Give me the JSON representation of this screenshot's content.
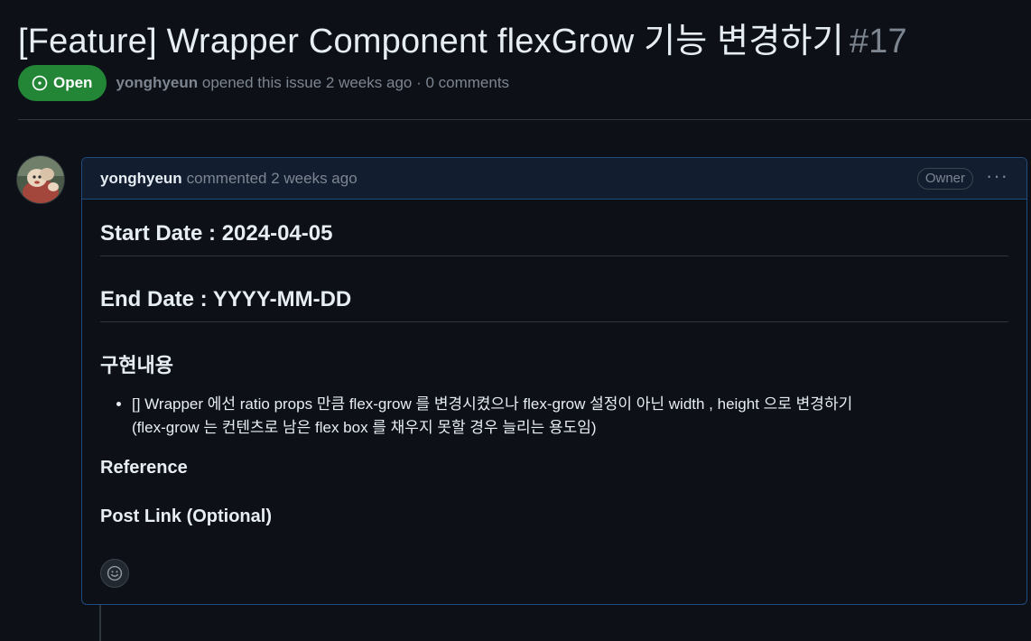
{
  "issue": {
    "title": "[Feature] Wrapper Component flexGrow 기능 변경하기",
    "number": "#17",
    "state": "Open",
    "author": "yonghyeun",
    "meta_text": "opened this issue 2 weeks ago · 0 comments"
  },
  "comment": {
    "author": "yonghyeun",
    "meta": "commented 2 weeks ago",
    "role_badge": "Owner",
    "menu_glyph": "···",
    "start_date": "Start Date : 2024-04-05",
    "end_date": "End Date : YYYY-MM-DD",
    "section_heading": "구현내용",
    "list_items": [
      {
        "line1": "[] Wrapper 에선 ratio props 만큼 flex-grow 를 변경시켰으나 flex-grow 설정이 아닌 width , height 으로 변경하기",
        "line2": "(flex-grow 는 컨텐츠로 남은 flex box 를 채우지 못할 경우 늘리는 용도임)"
      }
    ],
    "reference_heading": "Reference",
    "post_link_heading": "Post Link (Optional)"
  },
  "icons": {
    "state": "issue-opened-icon",
    "avatar": "avatar-image",
    "reaction": "smiley-icon",
    "menu": "kebab-horizontal-icon"
  },
  "colors": {
    "background": "#0d1117",
    "open_badge": "#238636",
    "comment_border": "#1f4b7e",
    "comment_header": "#121d2f",
    "muted_text": "#7d8590"
  }
}
